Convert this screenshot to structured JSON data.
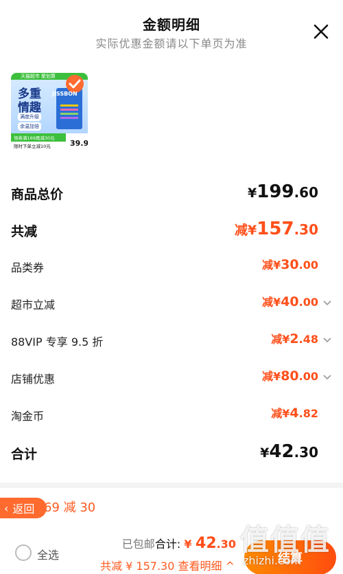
{
  "header": {
    "title": "金额明细",
    "subtitle": "实际优惠金额请以下单页为准"
  },
  "product": {
    "badge_store": "天猫超市",
    "badge_event": "聚划算",
    "promo_text_1": "多重",
    "promo_text_2": "情趣",
    "tag_1": "满度升级",
    "tag_2": "余温加倍",
    "brand": "JISSBON",
    "coupon": "领券满169再减30元",
    "limit": "限时下单立减10元",
    "price": "39.9"
  },
  "rows": [
    {
      "label": "商品总价",
      "prefix": "",
      "currency": "¥",
      "int": "199",
      "dec": ".60",
      "style": "total"
    },
    {
      "label": "共减",
      "prefix": "减",
      "currency": "¥",
      "int": "157",
      "dec": ".30",
      "style": "reduce-total"
    },
    {
      "label": "品类券",
      "prefix": "减",
      "currency": "¥",
      "int": "30",
      "dec": ".00",
      "style": "item",
      "chevron": false
    },
    {
      "label": "超市立减",
      "prefix": "减",
      "currency": "¥",
      "int": "40",
      "dec": ".00",
      "style": "item",
      "chevron": true
    },
    {
      "label": "88VIP 专享 9.5 折",
      "prefix": "减",
      "currency": "¥",
      "int": "2",
      "dec": ".48",
      "style": "item",
      "chevron": true
    },
    {
      "label": "店铺优惠",
      "prefix": "减",
      "currency": "¥",
      "int": "80",
      "dec": ".00",
      "style": "item",
      "chevron": true
    },
    {
      "label": "淘金币",
      "prefix": "减",
      "currency": "¥",
      "int": "4",
      "dec": ".82",
      "style": "item",
      "chevron": false
    },
    {
      "label": "合计",
      "prefix": "",
      "currency": "¥",
      "int": "42",
      "dec": ".30",
      "style": "total"
    }
  ],
  "promo_bar": {
    "back_label": "返回",
    "promo_text": "69 减 30"
  },
  "footer": {
    "select_all": "全选",
    "shipping": "已包邮",
    "total_label": "合计:",
    "total_currency": "¥",
    "total_int": "42",
    "total_dec": ".30",
    "reduce_line": "共减 ¥ 157.30 查看明细 ^",
    "settle": "结算"
  },
  "watermark": {
    "cn": "值值值",
    "en": "zhizhi.com"
  },
  "colors": {
    "accent": "#ff4f1a",
    "settle_start": "#ff8a00",
    "settle_end": "#ff4d0f"
  }
}
